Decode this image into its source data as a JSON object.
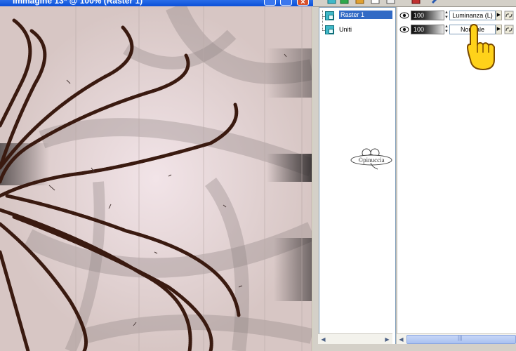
{
  "image_window": {
    "title": "Immagine 13* @ 100% (Raster 1)",
    "close_glyph": "×"
  },
  "layers": [
    {
      "name": "Raster 1",
      "opacity": "100",
      "blend_mode": "Luminanza (L)",
      "selected": true
    },
    {
      "name": "Uniti",
      "opacity": "100",
      "blend_mode": "Normale",
      "selected": false
    }
  ],
  "icons": {
    "visibility": "eye-icon",
    "link": "link-icon",
    "layer": "raster-layer-icon",
    "pointer": "pointing-hand-icon",
    "watermark": "clover-logo-icon"
  },
  "colors": {
    "title_bar": "#0a4fd8",
    "selection": "#316ac5",
    "layer_icon": "#40b8c8",
    "canvas_base": "#e2d3cc",
    "stroke": "#3a1a10"
  },
  "watermark_text": "©pinuccia"
}
